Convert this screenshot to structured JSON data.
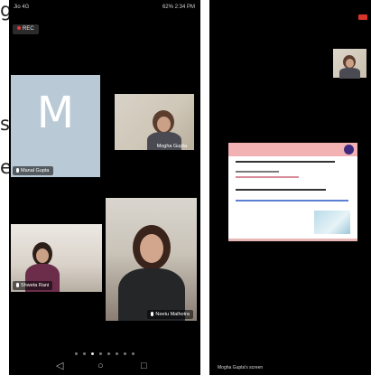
{
  "page_edge": {
    "g": "g",
    "s": "s",
    "e": "e"
  },
  "left_phone": {
    "status_left": "Jio 4G",
    "status_right": "62% 2:34 PM",
    "rec_label": "REC",
    "participants": [
      {
        "name": "Manal Gupta",
        "initial": "M"
      },
      {
        "name": "Mogha Gupta"
      },
      {
        "name": "Shweta Rani"
      },
      {
        "name": "Neetu Malhotra"
      }
    ],
    "pages": 8,
    "active_page": 2
  },
  "right_phone": {
    "sharer_label": "Mogha Gupta's screen",
    "pages": 6,
    "active_page": 1
  },
  "colors": {
    "avatar_bg": "#b9cad6",
    "leave_red": "#d9342b",
    "slide_header_pink": "#f2b2b4"
  },
  "icons": [
    "mic-icon",
    "back-icon",
    "home-icon",
    "recent-apps-icon",
    "record-dot-icon"
  ]
}
